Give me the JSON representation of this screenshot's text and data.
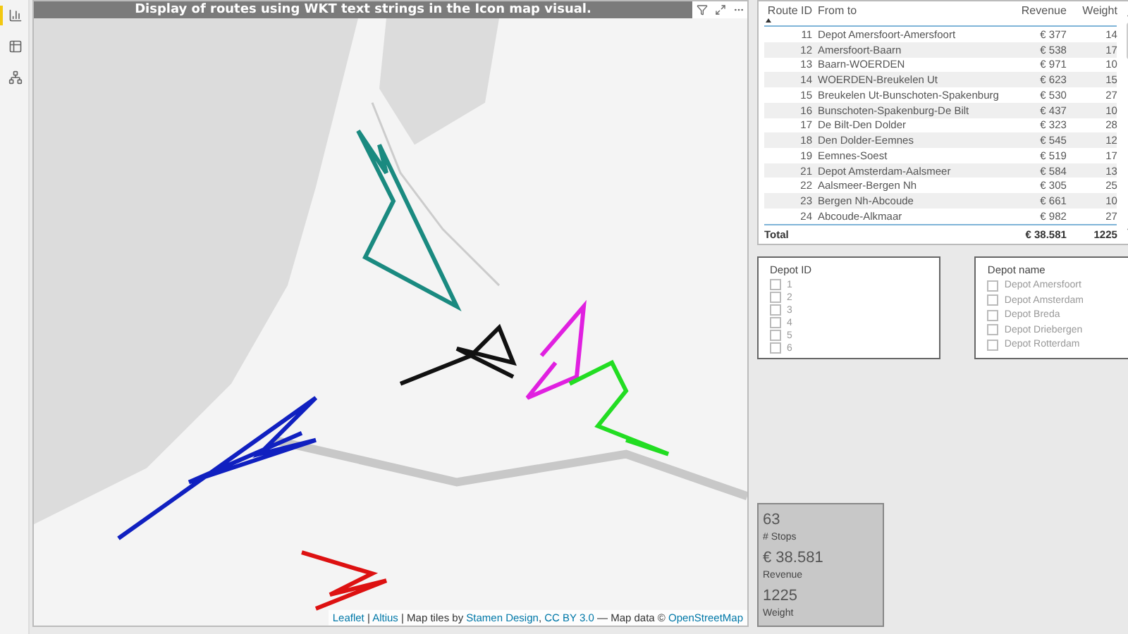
{
  "map": {
    "title": "Display of routes using WKT text strings in the Icon map visual.",
    "attribution": [
      {
        "text": "Leaflet",
        "link": true
      },
      {
        "text": " | ",
        "link": false
      },
      {
        "text": "Altius",
        "link": true
      },
      {
        "text": " | Map tiles by ",
        "link": false
      },
      {
        "text": "Stamen Design",
        "link": true
      },
      {
        "text": ", ",
        "link": false
      },
      {
        "text": "CC BY 3.0",
        "link": true
      },
      {
        "text": " — Map data © ",
        "link": false
      },
      {
        "text": "OpenStreetMap",
        "link": true
      }
    ]
  },
  "table": {
    "columns": [
      {
        "label": "Route ID",
        "sorted": true
      },
      {
        "label": "From to",
        "sorted": false
      },
      {
        "label": "Revenue",
        "sorted": false
      },
      {
        "label": "Weight",
        "sorted": false
      }
    ],
    "rows": [
      [
        "11",
        "Depot Amersfoort-Amersfoort",
        "€ 377",
        "14"
      ],
      [
        "12",
        "Amersfoort-Baarn",
        "€ 538",
        "17"
      ],
      [
        "13",
        "Baarn-WOERDEN",
        "€ 971",
        "10"
      ],
      [
        "14",
        "WOERDEN-Breukelen Ut",
        "€ 623",
        "15"
      ],
      [
        "15",
        "Breukelen Ut-Bunschoten-Spakenburg",
        "€ 530",
        "27"
      ],
      [
        "16",
        "Bunschoten-Spakenburg-De Bilt",
        "€ 437",
        "10"
      ],
      [
        "17",
        "De Bilt-Den Dolder",
        "€ 323",
        "28"
      ],
      [
        "18",
        "Den Dolder-Eemnes",
        "€ 545",
        "12"
      ],
      [
        "19",
        "Eemnes-Soest",
        "€ 519",
        "17"
      ],
      [
        "21",
        "Depot Amsterdam-Aalsmeer",
        "€ 584",
        "13"
      ],
      [
        "22",
        "Aalsmeer-Bergen Nh",
        "€ 305",
        "25"
      ],
      [
        "23",
        "Bergen Nh-Abcoude",
        "€ 661",
        "10"
      ],
      [
        "24",
        "Abcoude-Alkmaar",
        "€ 982",
        "27"
      ]
    ],
    "total": {
      "label": "Total",
      "revenue": "€ 38.581",
      "weight": "1225"
    }
  },
  "slicers": [
    {
      "title": "Depot ID",
      "items": [
        {
          "label": "1",
          "checked": false
        },
        {
          "label": "2",
          "checked": false
        },
        {
          "label": "3",
          "checked": false
        },
        {
          "label": "4",
          "checked": false
        },
        {
          "label": "5",
          "checked": false
        },
        {
          "label": "6",
          "checked": false
        }
      ]
    },
    {
      "title": "Depot name",
      "items": [
        {
          "label": "Depot Amersfoort",
          "checked": false
        },
        {
          "label": "Depot Amsterdam",
          "checked": false
        },
        {
          "label": "Depot Breda",
          "checked": false
        },
        {
          "label": "Depot Driebergen",
          "checked": false
        },
        {
          "label": "Depot Rotterdam",
          "checked": false
        }
      ]
    }
  ],
  "card": [
    {
      "value": "63",
      "label": "# Stops"
    },
    {
      "value": "€ 38.581",
      "label": "Revenue"
    },
    {
      "value": "1225",
      "label": "Weight"
    }
  ]
}
